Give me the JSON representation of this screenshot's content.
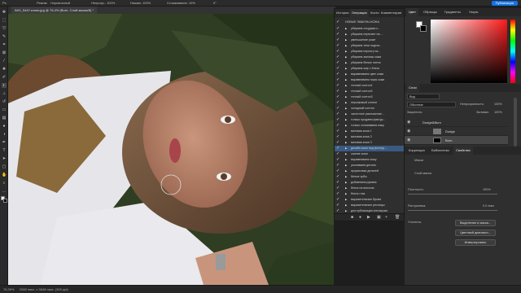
{
  "topbar": {
    "mode": "Режим:",
    "mode_value": "Нормальный",
    "opacity": "Непрозр.: 100%",
    "flow": "Нажим: 100%",
    "smoothing": "Сглаживание: 10%",
    "angle": "0°",
    "publish": "Публикация"
  },
  "doc": {
    "tab": "IMG_5442 копия.jpg @ 76,4% (Burn, Слой-маска/8) *"
  },
  "history": {
    "tabs": [
      "История",
      "Операции",
      "Кисти",
      "Комментарии"
    ],
    "active_tab": 1,
    "folder": "НОВЫЕ ЭКШЕНЫ КОЖА",
    "items": [
      "убираем сосудики к...",
      "убираем пересвет на ...",
      "уменьшение роже",
      "убираем тени подгла...",
      "убираем перхоту на...",
      "убираем заломы кожи",
      "убираем белые пятна",
      "убираем жир с блеск",
      "выравниваем цвет кожи",
      "выравниваем поры кожи",
      "теплый сонтон1",
      "теплый сонтон2",
      "теплый сонтон3",
      "персиковый сонтон",
      "холодный сонтон",
      "частотное разложение...",
      "только продаем фактур...",
      "только сглаживаем кожу",
      "матовая кожа 1",
      "матовая кожа 2",
      "матовая кожа 3",
      "дизайн кожи под фонтур...",
      "сияние кожи",
      "выравниваем кожу",
      "усиливаем детали",
      "прорисовка деталей",
      "белые зубы",
      "добавляем румяна",
      "блеск на волосах",
      "блеск глаз",
      "выразительные брови",
      "выразительные ресницы",
      "для публикации инстаграм",
      "экшен шаговый"
    ],
    "selected_index": 21
  },
  "color_panel": {
    "tabs": [
      "Цвет",
      "Образцы",
      "Градиенты",
      "Узоры"
    ]
  },
  "layers_panel": {
    "title": "Слои",
    "search": "Вид",
    "blend": "Обычные",
    "opacity_label": "Непрозрачность:",
    "opacity_value": "100%",
    "lock_label": "Закрепить:",
    "fill_label": "Заливка:",
    "fill_value": "100%",
    "layers": [
      "Dodge&Burn",
      "Dodge",
      "Burn"
    ],
    "selected_layer": 2
  },
  "properties_panel": {
    "tabs": [
      "Коррекция",
      "Библиотеки",
      "Свойства"
    ],
    "section": "Маски",
    "mask_label": "Слой-маска",
    "density_label": "Плотность:",
    "density_value": "100%",
    "feather_label": "Растушевка:",
    "feather_value": "0,0 пикс",
    "refine_label": "Уточнить:",
    "select_mask_btn": "Выделение и маска...",
    "color_range_btn": "Цветовой диапазон...",
    "invert_btn": "Инвертировать"
  },
  "status": {
    "zoom": "76,39%",
    "size": "2560 пикс. x 3648 пикс. (300 ppi)"
  },
  "colors": {
    "accent": "#1473e6",
    "selection": "#3a5a82"
  }
}
